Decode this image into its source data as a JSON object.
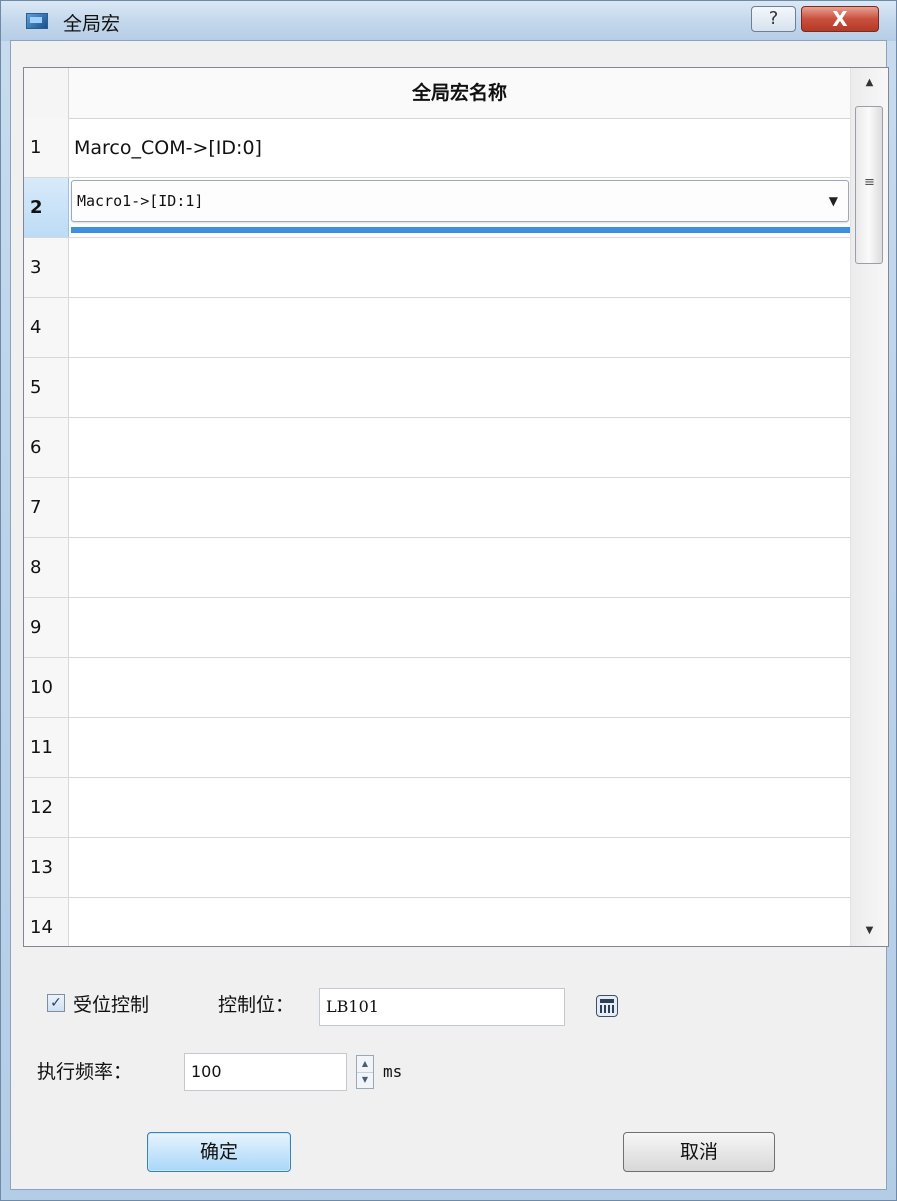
{
  "window": {
    "title": "全局宏",
    "help_glyph": "?",
    "close_glyph": "X"
  },
  "grid": {
    "column_header": "全局宏名称",
    "rows": [
      {
        "num": "1",
        "value": "Marco_COM->[ID:0]"
      },
      {
        "num": "2",
        "value": "Macro1->[ID:1]"
      },
      {
        "num": "3",
        "value": ""
      },
      {
        "num": "4",
        "value": ""
      },
      {
        "num": "5",
        "value": ""
      },
      {
        "num": "6",
        "value": ""
      },
      {
        "num": "7",
        "value": ""
      },
      {
        "num": "8",
        "value": ""
      },
      {
        "num": "9",
        "value": ""
      },
      {
        "num": "10",
        "value": ""
      },
      {
        "num": "11",
        "value": ""
      },
      {
        "num": "12",
        "value": ""
      },
      {
        "num": "13",
        "value": ""
      },
      {
        "num": "14",
        "value": ""
      }
    ],
    "selected_row": "2"
  },
  "controls": {
    "bit_control_checkbox_label": "受位控制",
    "bit_control_checked": true,
    "control_bit_label": "控制位：",
    "control_bit_value": "LB101",
    "exec_freq_label": "执行频率：",
    "exec_freq_value": "100",
    "unit": "ms"
  },
  "buttons": {
    "ok": "确定",
    "cancel": "取消"
  }
}
